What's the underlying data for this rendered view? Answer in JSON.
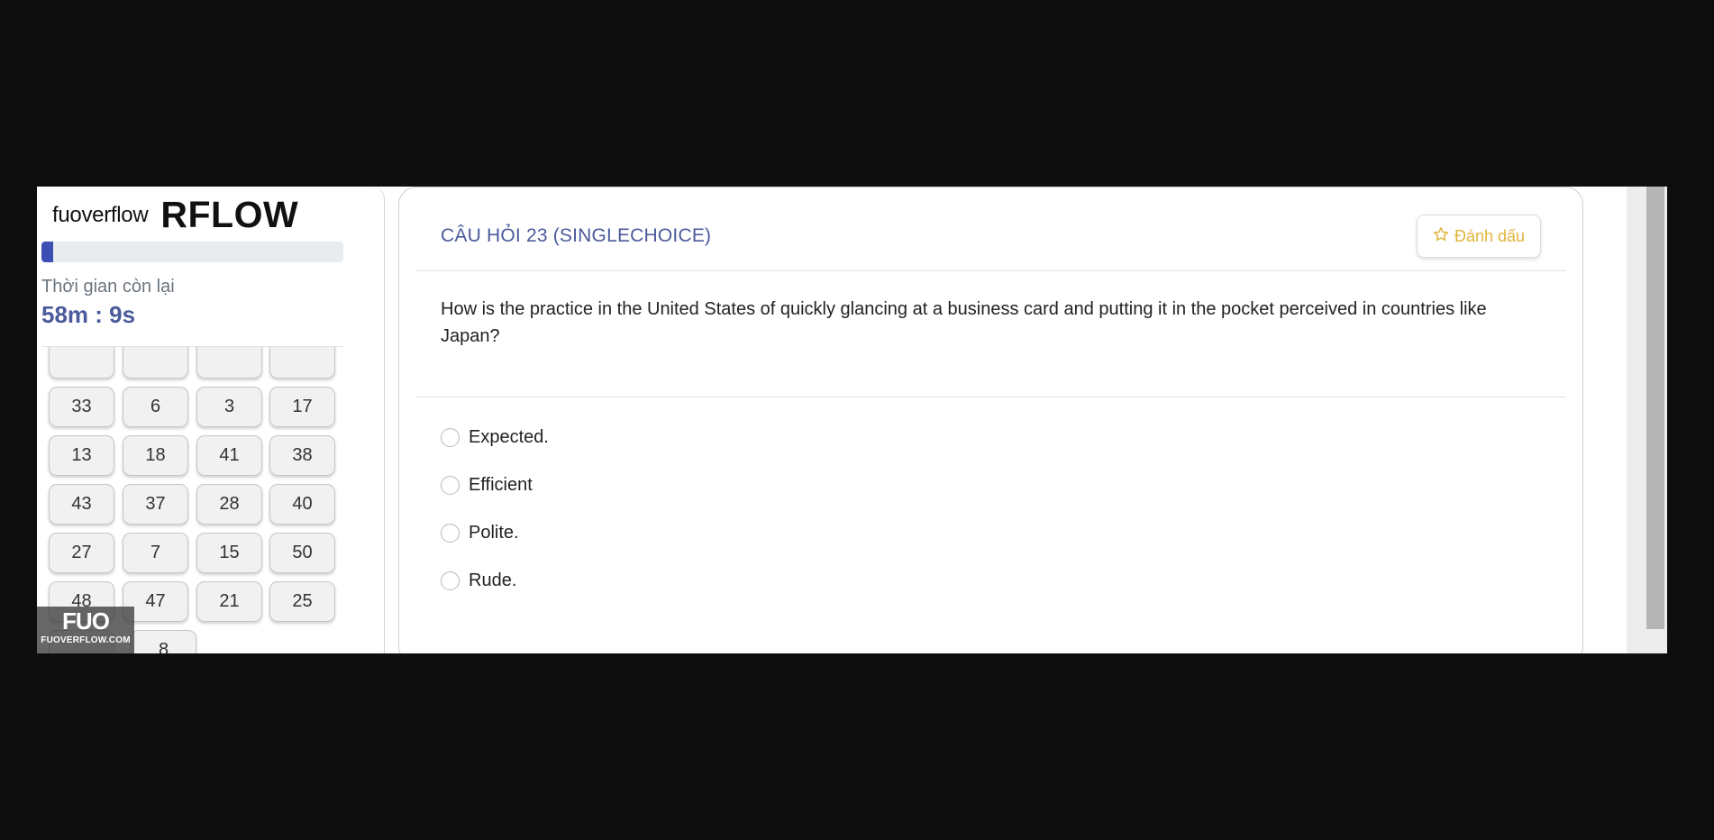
{
  "brand": {
    "small": "fuoverflow",
    "big": "RFLOW"
  },
  "progress": {
    "fraction": 0.04
  },
  "timer": {
    "label": "Thời gian còn lại",
    "value": "58m : 9s"
  },
  "question_nav": {
    "partial_top": [
      "",
      "",
      "",
      ""
    ],
    "rows": [
      [
        "33",
        "6",
        "3",
        "17"
      ],
      [
        "13",
        "18",
        "41",
        "38"
      ],
      [
        "43",
        "37",
        "28",
        "40"
      ],
      [
        "27",
        "7",
        "15",
        "50"
      ],
      [
        "48",
        "47",
        "21",
        "25"
      ]
    ],
    "partial_bottom": [
      "",
      "8"
    ]
  },
  "watermark": {
    "logo": "FUO",
    "site": "FUOVERFLOW.COM"
  },
  "question": {
    "header": "CÂU HỎI 23 (SINGLECHOICE)",
    "mark_label": "Đánh dấu",
    "text": "How is the practice in the United States of quickly glancing at a business card and putting it in the pocket perceived in countries like Japan?",
    "options": [
      "Expected.",
      "Efficient",
      "Polite.",
      "Rude."
    ]
  },
  "colors": {
    "accent": "#4b5a9b",
    "progress": "#3c4fb3",
    "mark": "#e0b43c"
  }
}
